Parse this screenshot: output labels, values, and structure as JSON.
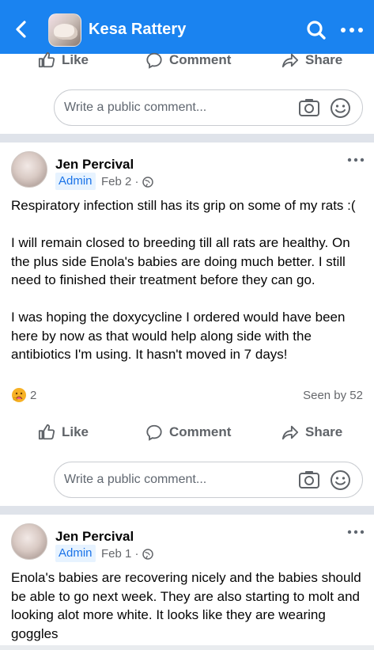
{
  "header": {
    "title": "Kesa Rattery"
  },
  "actions": {
    "like": "Like",
    "comment": "Comment",
    "share": "Share"
  },
  "comment_box": {
    "placeholder": "Write a public comment..."
  },
  "posts": [
    {
      "author": "Jen Percival",
      "badge": "Admin",
      "date": "Feb 2 ·",
      "paragraphs": [
        "Respiratory infection still has its grip on some of my rats :(",
        "I will remain closed to breeding till all rats are healthy. On the plus side Enola's babies are doing much better. I still need to finished their treatment before they can go.",
        "I was hoping the doxycycline I ordered would have been here by now as that would help along side with the antibiotics I'm using.  It hasn't moved in 7 days!"
      ],
      "reaction_count": "2",
      "seen": "Seen by 52"
    },
    {
      "author": "Jen Percival",
      "badge": "Admin",
      "date": "Feb 1 ·",
      "paragraphs": [
        "Enola's babies are recovering nicely and the babies should be able to go next week. They are also starting to molt and looking alot more white. It looks like they are wearing goggles"
      ]
    }
  ],
  "icons": {
    "back": "chevron-left-icon",
    "search": "search-icon",
    "more": "more-dots-icon",
    "like": "thumbs-up-icon",
    "comment": "comment-bubble-icon",
    "share": "share-arrow-icon",
    "camera": "camera-icon",
    "emoji": "smiley-icon",
    "globe": "globe-icon",
    "reaction": "care-reaction-icon"
  },
  "colors": {
    "header_bg": "#1a83f0",
    "admin_badge_bg": "#e7f3ff",
    "admin_badge_text": "#1a73e8",
    "separator": "#dfe3ea"
  }
}
